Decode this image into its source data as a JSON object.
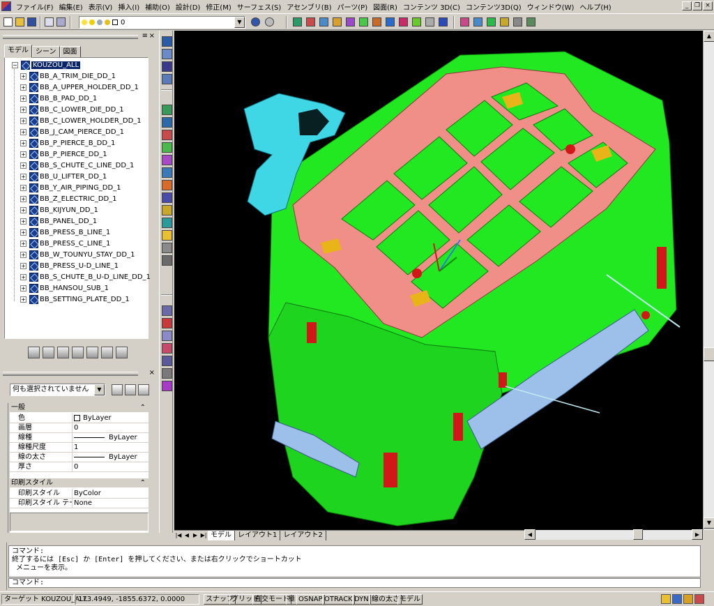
{
  "menu": [
    "ファイル(F)",
    "編集(E)",
    "表示(V)",
    "挿入(I)",
    "補助(O)",
    "設計(D)",
    "修正(M)",
    "サーフェス(S)",
    "アセンブリ(B)",
    "パーツ(P)",
    "図面(R)",
    "コンテンツ 3D(C)",
    "コンテンツ3D(Q)",
    "ウィンドウ(W)",
    "ヘルプ(H)"
  ],
  "window_controls": [
    "_",
    "❐",
    "×"
  ],
  "toolbar": {
    "layer_value": "0"
  },
  "model_panel": {
    "tabs": [
      "モデル",
      "シーン",
      "図面"
    ],
    "root": "KOUZOU_ALL",
    "items": [
      "BB_A_TRIM_DIE_DD_1",
      "BB_A_UPPER_HOLDER_DD_1",
      "BB_B_PAD_DD_1",
      "BB_C_LOWER_DIE_DD_1",
      "BB_C_LOWER_HOLDER_DD_1",
      "BB_J_CAM_PIERCE_DD_1",
      "BB_P_PIERCE_B_DD_1",
      "BB_P_PIERCE_DD_1",
      "BB_S_CHUTE_C_LINE_DD_1",
      "BB_U_LIFTER_DD_1",
      "BB_Y_AIR_PIPING_DD_1",
      "BB_Z_ELECTRIC_DD_1",
      "BB_KIJYUN_DD_1",
      "BB_PANEL_DD_1",
      "BB_PRESS_B_LINE_1",
      "BB_PRESS_C_LINE_1",
      "BB_W_TOUNYU_STAY_DD_1",
      "BB_PRESS_U-D_LINE_1",
      "BB_S_CHUTE_B_U-D_LINE_DD_1",
      "BB_HANSOU_SUB_1",
      "BB_SETTING_PLATE_DD_1"
    ]
  },
  "properties": {
    "selection": "何も選択されていません",
    "general_title": "一般",
    "general": [
      {
        "name": "色",
        "value": "ByLayer"
      },
      {
        "name": "画層",
        "value": "0"
      },
      {
        "name": "線種",
        "value": "ByLayer"
      },
      {
        "name": "線種尺度",
        "value": "1"
      },
      {
        "name": "線の太さ",
        "value": "ByLayer"
      },
      {
        "name": "厚さ",
        "value": "0"
      }
    ],
    "plot_title": "印刷スタイル",
    "plot": [
      {
        "name": "印刷スタイル",
        "value": "ByColor"
      },
      {
        "name": "印刷スタイル テー...",
        "value": "None"
      }
    ]
  },
  "layout_tabs": [
    "モデル",
    "レイアウト1",
    "レイアウト2"
  ],
  "command": {
    "history": [
      "コマンド:",
      "終了するには [Esc] か [Enter] を押してください、または右クリックでショートカット",
      " メニューを表示。"
    ],
    "prompt": "コマンド:"
  },
  "status": {
    "target": "ターゲット KOUZOU_ALL",
    "coords": "173.4949, -1855.6372, 0.0000",
    "toggles": [
      "スナップ",
      "グリッド",
      "直交モード",
      "極",
      "OSNAP",
      "OTRACK",
      "DYN",
      "線の太さ",
      "モデル"
    ]
  },
  "colors": {
    "viewport_bg": "#000000",
    "model_green": "#22e822",
    "model_pink": "#ef8f88",
    "model_cyan": "#3fd6e6",
    "model_red": "#d01818",
    "model_blue": "#9cc0ea",
    "model_yellow": "#e8b418"
  }
}
